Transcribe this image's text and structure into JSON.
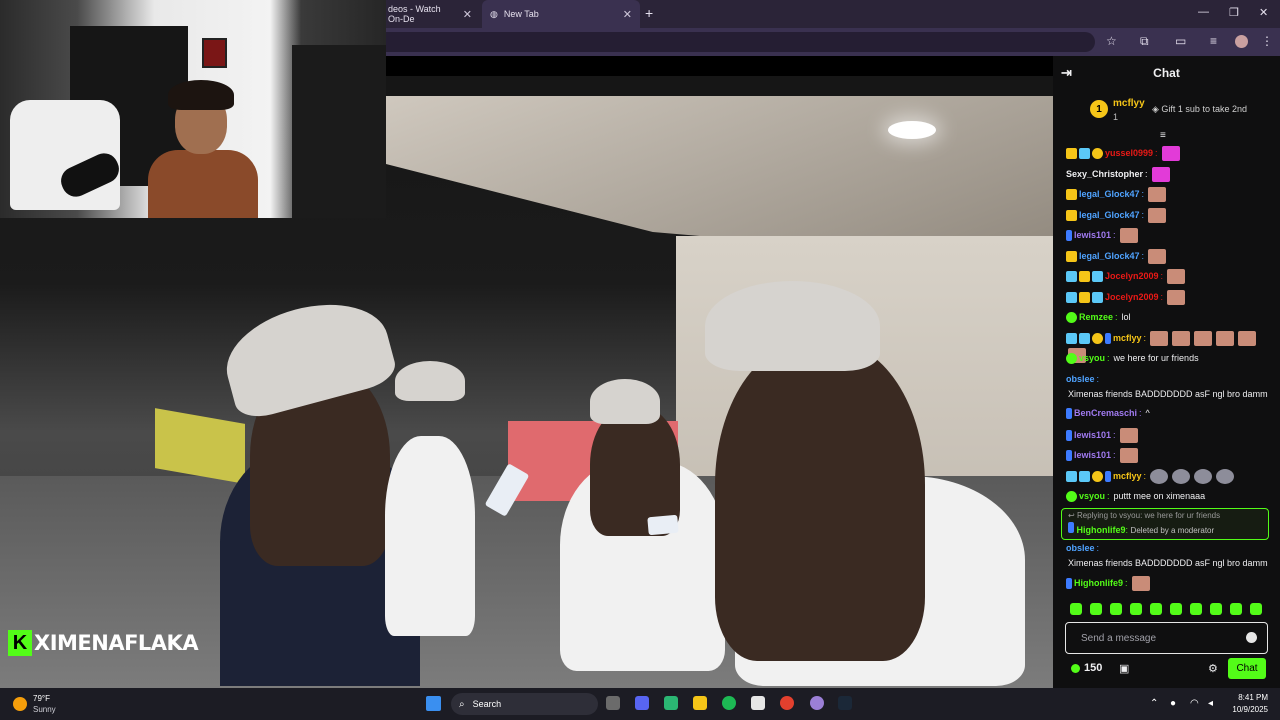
{
  "browser": {
    "tabs": [
      {
        "title": "deos - Watch On-De"
      },
      {
        "title": "New Tab"
      }
    ],
    "new_tab_symbol": "+",
    "window_controls": [
      "—",
      "❐",
      "✕"
    ]
  },
  "stream": {
    "channel_logo_letter": "K",
    "channel_name": "XIMENAFLAKA"
  },
  "chat": {
    "title": "Chat",
    "pinned": {
      "rank": "1",
      "username": "mcflyy",
      "count": "1",
      "gift_text": "Gift 1 sub to take 2nd"
    },
    "messages": [
      {
        "user": "yussel0999",
        "color": "#e91916",
        "text": "",
        "badges": [
          "gold",
          "cyan",
          "round"
        ],
        "emotes": [
          "pink"
        ]
      },
      {
        "user": "Sexy_Christopher",
        "color": "#efeff1",
        "text": "",
        "badges": [],
        "emotes": [
          "pink"
        ]
      },
      {
        "user": "legal_Glock47",
        "color": "#4fa3ff",
        "text": "",
        "badges": [
          "gold"
        ],
        "emotes": [
          "face"
        ]
      },
      {
        "user": "legal_Glock47",
        "color": "#4fa3ff",
        "text": "",
        "badges": [
          "gold"
        ],
        "emotes": [
          "face"
        ]
      },
      {
        "user": "lewis101",
        "color": "#a07af0",
        "text": "",
        "badges": [
          "pen"
        ],
        "emotes": [
          "face"
        ]
      },
      {
        "user": "legal_Glock47",
        "color": "#4fa3ff",
        "text": "",
        "badges": [
          "gold"
        ],
        "emotes": [
          "face"
        ]
      },
      {
        "user": "Jocelyn2009",
        "color": "#e91916",
        "text": "",
        "badges": [
          "cyan",
          "gold",
          "cyan"
        ],
        "emotes": [
          "face"
        ]
      },
      {
        "user": "Jocelyn2009",
        "color": "#e91916",
        "text": "",
        "badges": [
          "cyan",
          "gold",
          "cyan"
        ],
        "emotes": [
          "face"
        ]
      },
      {
        "user": "Remzee",
        "color": "#53fc18",
        "text": "lol",
        "badges": [
          "green"
        ],
        "emotes": []
      },
      {
        "user": "mcflyy",
        "color": "#f5c518",
        "text": "",
        "badges": [
          "cyan",
          "cyan",
          "round",
          "pen"
        ],
        "emotes": [
          "face",
          "face",
          "face",
          "face",
          "face",
          "face"
        ]
      },
      {
        "user": "vsyou",
        "color": "#53fc18",
        "text": "we here for ur friends",
        "badges": [
          "green"
        ],
        "emotes": []
      },
      {
        "user": "obslee",
        "color": "#4fa3ff",
        "text": "Ximenas friends BADDDDDDD asF ngl bro damm",
        "badges": [],
        "emotes": []
      },
      {
        "user": "BenCremaschi",
        "color": "#a07af0",
        "text": "^",
        "badges": [
          "pen"
        ],
        "emotes": []
      },
      {
        "user": "lewis101",
        "color": "#a07af0",
        "text": "",
        "badges": [
          "pen"
        ],
        "emotes": [
          "face"
        ]
      },
      {
        "user": "lewis101",
        "color": "#a07af0",
        "text": "",
        "badges": [
          "pen"
        ],
        "emotes": [
          "face"
        ]
      },
      {
        "user": "mcflyy",
        "color": "#f5c518",
        "text": "",
        "badges": [
          "cyan",
          "cyan",
          "round",
          "pen"
        ],
        "emotes": [
          "gray",
          "gray",
          "gray",
          "gray"
        ]
      },
      {
        "user": "vsyou",
        "color": "#53fc18",
        "text": "puttt mee on ximenaaa",
        "badges": [
          "green"
        ],
        "emotes": []
      }
    ],
    "reply": {
      "context": "Replying to vsyou: we here for ur friends",
      "user": "Highonlife9",
      "text": "Deleted by a moderator"
    },
    "after_reply": [
      {
        "user": "obslee",
        "color": "#4fa3ff",
        "text": "Ximenas friends BADDDDDDD asF ngl bro damm",
        "badges": [],
        "emotes": []
      },
      {
        "user": "Highonlife9",
        "color": "#53fc18",
        "text": "",
        "badges": [
          "pen"
        ],
        "emotes": [
          "face"
        ]
      }
    ],
    "input_placeholder": "Send a message",
    "points": "150",
    "send_label": "Chat"
  },
  "taskbar": {
    "temperature": "79°F",
    "condition": "Sunny",
    "search_label": "Search",
    "time": "8:41 PM",
    "date": "10/9/2025"
  },
  "colors": {
    "accent": "#53fc18",
    "chat_bg": "#0f0f10",
    "browser_bg": "#2b2438"
  }
}
